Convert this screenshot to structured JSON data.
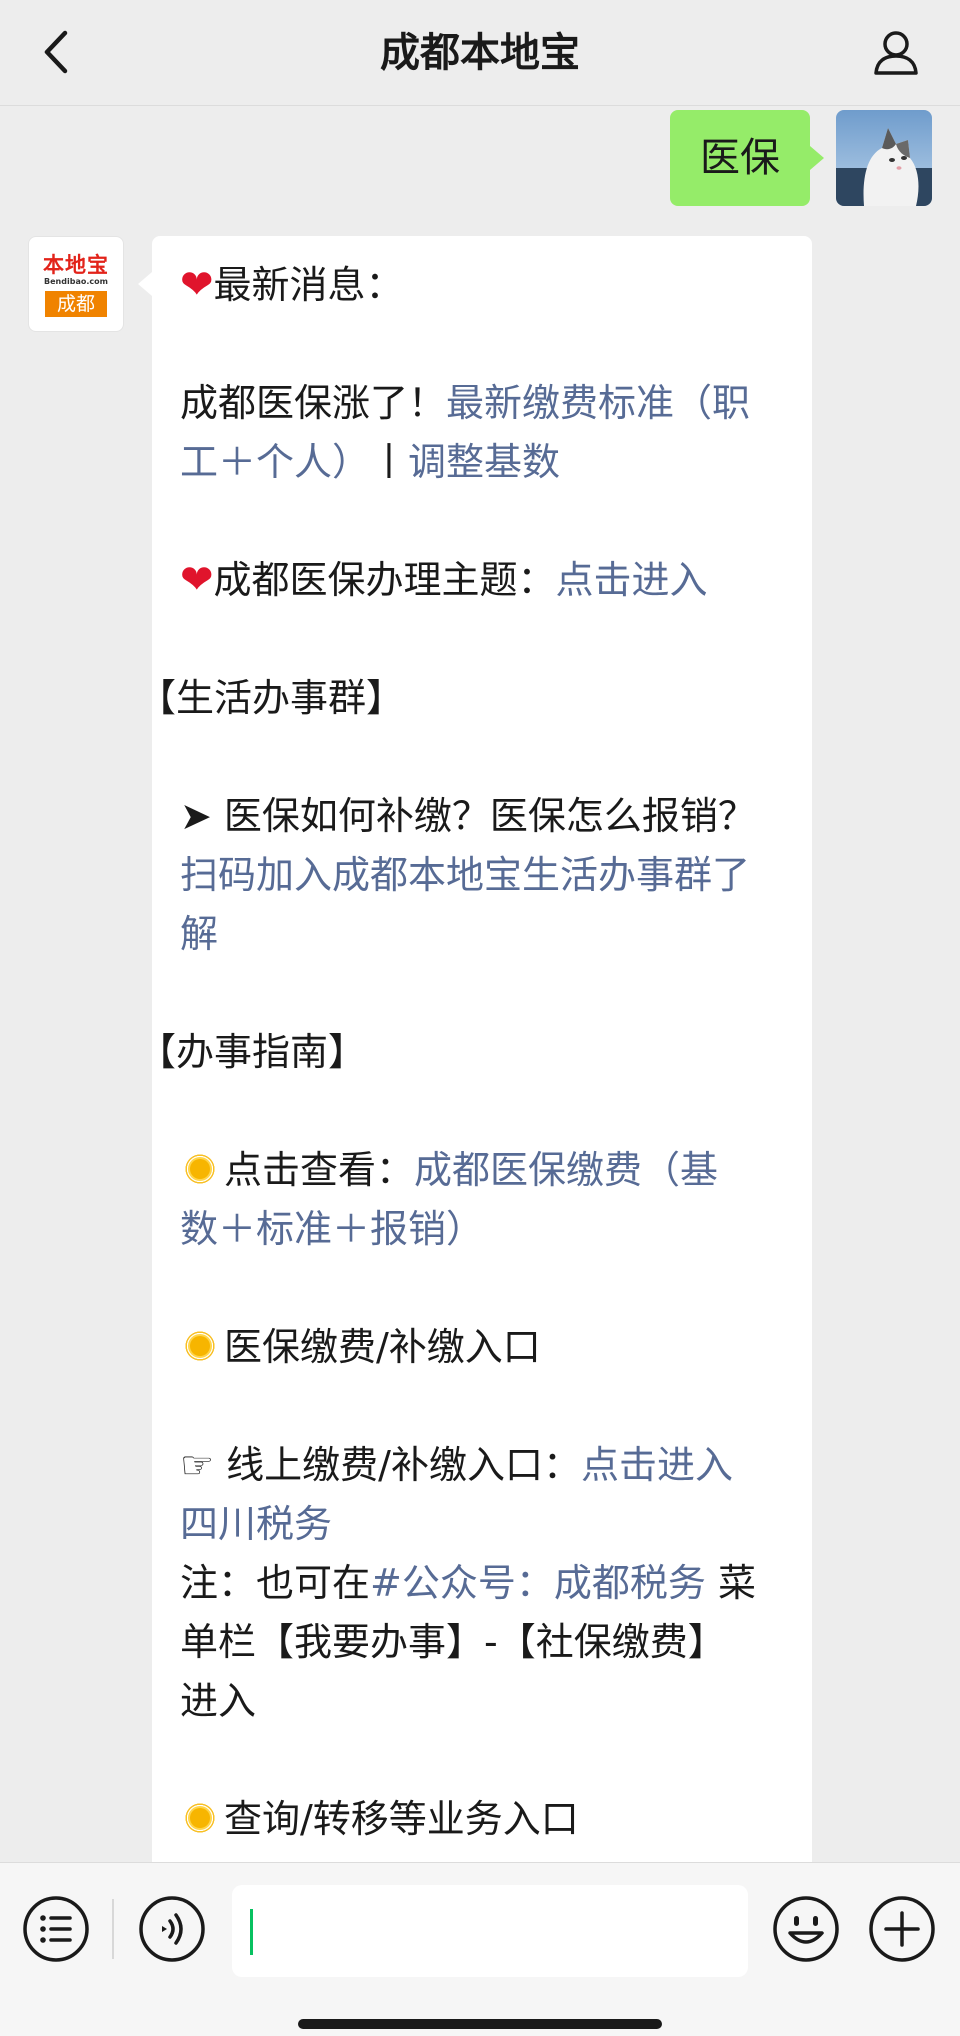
{
  "header": {
    "title": "成都本地宝",
    "back_icon": "chevron-left-icon",
    "profile_icon": "person-icon"
  },
  "my_message": {
    "text": "医保",
    "bubble_color": "#95ec69"
  },
  "bot": {
    "avatar": {
      "logo_text": "本地宝",
      "logo_sub": "Bendibao.com",
      "city": "成都"
    },
    "message": {
      "latest_label": "最新消息：",
      "news_text": "成都医保涨了！",
      "news_link_1": "最新缴费标准（职",
      "news_link_1b": "工＋个人）",
      "news_sep": "丨",
      "news_link_2": "调整基数",
      "topic_label": "成都医保办理主题：",
      "topic_link": "点击进入",
      "group_heading": "【生活办事群】",
      "group_question": "➤ 医保如何补缴？医保怎么报销？",
      "group_link_1": "扫码加入成都本地宝生活办事群了",
      "group_link_2": "解",
      "guide_heading": "【办事指南】",
      "guide_view_label": "点击查看：",
      "guide_view_link_1": "成都医保缴费（基",
      "guide_view_link_2": "数＋标准＋报销）",
      "payment_entry": "医保缴费/补缴入口",
      "online_label": "☞ 线上缴费/补缴入口：",
      "online_link_1": "点击进入",
      "online_link_2": "四川税务",
      "note_prefix": "注：也可在",
      "note_link": "#公众号：成都税务",
      "note_suffix": " 菜",
      "note_line_2": "单栏【我要办事】-【社保缴费】",
      "note_line_3": "进入",
      "query_entry": "查询/转移等业务入口"
    }
  },
  "colors": {
    "link": "#576b95",
    "heart": "#e0142c",
    "sun": "#f7b500",
    "caret": "#07c160"
  },
  "bottom_bar": {
    "menu_icon": "list-menu-icon",
    "voice_icon": "voice-icon",
    "input_value": "",
    "emoji_icon": "smiley-icon",
    "plus_icon": "plus-icon"
  }
}
